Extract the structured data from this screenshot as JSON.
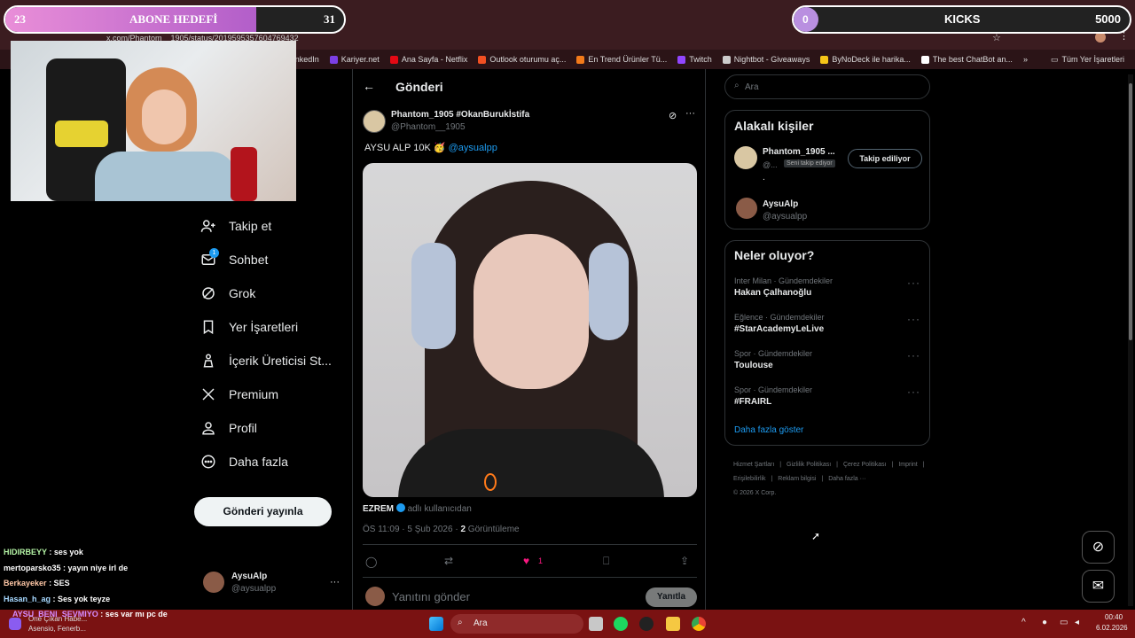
{
  "browser": {
    "url": "x.com/Phantom__1905/status/2019595357604769432",
    "bookmarks": [
      {
        "label": "İş İlanları | LinkedIn",
        "color": "#0a66c2"
      },
      {
        "label": "Kariyer.net",
        "color": "#7b3fe4"
      },
      {
        "label": "Ana Sayfa - Netflix",
        "color": "#e50914"
      },
      {
        "label": "Outlook oturumu aç...",
        "color": "#f25022"
      },
      {
        "label": "En Trend Ürünler Tü...",
        "color": "#f27a1a"
      },
      {
        "label": "Twitch",
        "color": "#9146ff"
      },
      {
        "label": "Nightbot - Giveaways",
        "color": "#cccccc"
      },
      {
        "label": "ByNoDeck ile harika...",
        "color": "#f5c518"
      },
      {
        "label": "The best ChatBot an...",
        "color": "#ffffff"
      }
    ],
    "bookmarks_more": "»",
    "all_bookmarks": "Tüm Yer İşaretleri"
  },
  "overlay": {
    "sub_goal": {
      "current": "23",
      "label": "ABONE HEDEFİ",
      "target": "31",
      "progress": 0.74
    },
    "kicks": {
      "current": "0",
      "label": "KICKS",
      "target": "5000",
      "progress": 0.0
    }
  },
  "sidebar": {
    "items": [
      {
        "label": "Takip et",
        "icon": "person-plus-icon"
      },
      {
        "label": "Sohbet",
        "icon": "mail-icon",
        "badge": "1"
      },
      {
        "label": "Grok",
        "icon": "grok-icon"
      },
      {
        "label": "Yer İşaretleri",
        "icon": "bookmark-icon"
      },
      {
        "label": "İçerik Üreticisi St...",
        "icon": "creator-icon"
      },
      {
        "label": "Premium",
        "icon": "x-icon"
      },
      {
        "label": "Profil",
        "icon": "profile-icon"
      },
      {
        "label": "Daha fazla",
        "icon": "more-circle-icon"
      }
    ],
    "post_button": "Gönderi yayınla",
    "account": {
      "name": "AysuAlp",
      "handle": "@aysualpp",
      "more": "···"
    }
  },
  "post": {
    "header_title": "Gönderi",
    "author_name": "Phantom_1905 #OkanBurukİstifa",
    "author_handle": "@Phantom__1905",
    "text": "AYSU ALP 10K 🥳",
    "mention": "@aysualpp",
    "media_caption_user": "EZREM",
    "media_caption_rest": "adlı kullanıcıdan",
    "time": "ÖS 11:09 · 5 Şub 2026 ·",
    "views_count": "2",
    "views_label": "Görüntüleme",
    "like_count": "1",
    "reply_placeholder": "Yanıtını gönder",
    "reply_button": "Yanıtla"
  },
  "right": {
    "search_placeholder": "Ara",
    "relevant_title": "Alakalı kişiler",
    "people": [
      {
        "name": "Phantom_1905 ...",
        "handle": "@...",
        "badge": "Seni takip ediyor",
        "bio": ".",
        "button": "Takip ediliyor"
      },
      {
        "name": "AysuAlp",
        "handle": "@aysualpp"
      }
    ],
    "trends_title": "Neler oluyor?",
    "trends": [
      {
        "category": "Inter Milan · Gündemdekiler",
        "name": "Hakan Çalhanoğlu"
      },
      {
        "category": "Eğlence · Gündemdekiler",
        "name": "#StarAcademyLeLive"
      },
      {
        "category": "Spor · Gündemdekiler",
        "name": "Toulouse"
      },
      {
        "category": "Spor · Gündemdekiler",
        "name": "#FRAIRL"
      }
    ],
    "show_more": "Daha fazla göster",
    "footer_links": [
      "Hizmet Şartları",
      "|",
      "Gizlilik Politikası",
      "|",
      "Çerez Politikası",
      "|",
      "Imprint",
      "|",
      "Erişilebilirlik",
      "|",
      "Reklam bilgisi",
      "|",
      "Daha fazla ···"
    ],
    "copyright": "© 2026 X Corp."
  },
  "chat": [
    {
      "user": "HIDIRBEYY",
      "msg": ": ses yok",
      "color": "#b5f5a6"
    },
    {
      "user": "mertoparsko35",
      "msg": ": yayın niye irl de",
      "color": "#ffffff"
    },
    {
      "user": "Berkayeker",
      "msg": ": SES",
      "color": "#ffc7a6"
    },
    {
      "user": "Hasan_h_ag",
      "msg": ": Ses yok teyze",
      "color": "#a6d8ff"
    },
    {
      "user": "AYSU_BENI_SEVMIYO",
      "msg": ": ses var mı pc de",
      "color": "#d68bff"
    }
  ],
  "taskbar": {
    "search": "Ara",
    "news_title": "Öne Çıkan Habe...",
    "news_sub": "Asensio, Fenerb...",
    "time": "00:40",
    "date": "6.02.2026"
  }
}
